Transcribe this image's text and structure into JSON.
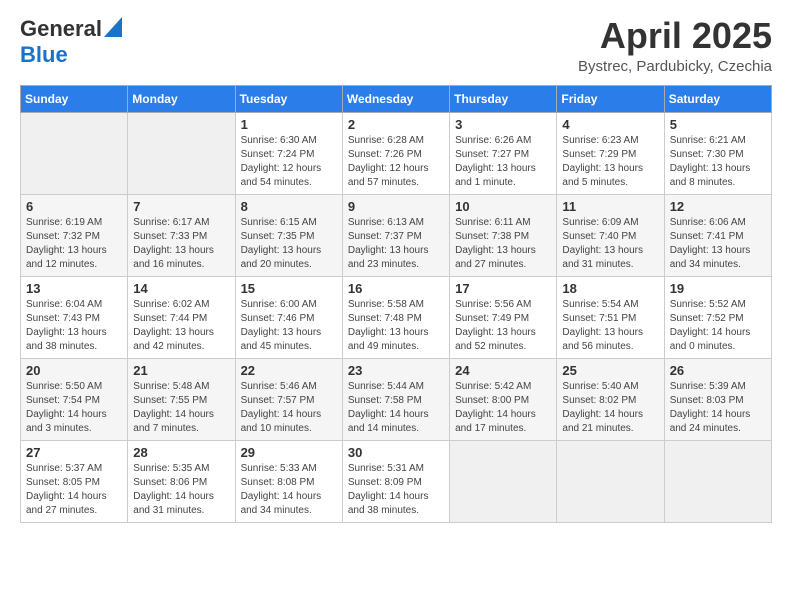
{
  "header": {
    "logo_general": "General",
    "logo_blue": "Blue",
    "month_title": "April 2025",
    "location": "Bystrec, Pardubicky, Czechia"
  },
  "weekdays": [
    "Sunday",
    "Monday",
    "Tuesday",
    "Wednesday",
    "Thursday",
    "Friday",
    "Saturday"
  ],
  "weeks": [
    [
      {
        "day": "",
        "info": ""
      },
      {
        "day": "",
        "info": ""
      },
      {
        "day": "1",
        "info": "Sunrise: 6:30 AM\nSunset: 7:24 PM\nDaylight: 12 hours\nand 54 minutes."
      },
      {
        "day": "2",
        "info": "Sunrise: 6:28 AM\nSunset: 7:26 PM\nDaylight: 12 hours\nand 57 minutes."
      },
      {
        "day": "3",
        "info": "Sunrise: 6:26 AM\nSunset: 7:27 PM\nDaylight: 13 hours\nand 1 minute."
      },
      {
        "day": "4",
        "info": "Sunrise: 6:23 AM\nSunset: 7:29 PM\nDaylight: 13 hours\nand 5 minutes."
      },
      {
        "day": "5",
        "info": "Sunrise: 6:21 AM\nSunset: 7:30 PM\nDaylight: 13 hours\nand 8 minutes."
      }
    ],
    [
      {
        "day": "6",
        "info": "Sunrise: 6:19 AM\nSunset: 7:32 PM\nDaylight: 13 hours\nand 12 minutes."
      },
      {
        "day": "7",
        "info": "Sunrise: 6:17 AM\nSunset: 7:33 PM\nDaylight: 13 hours\nand 16 minutes."
      },
      {
        "day": "8",
        "info": "Sunrise: 6:15 AM\nSunset: 7:35 PM\nDaylight: 13 hours\nand 20 minutes."
      },
      {
        "day": "9",
        "info": "Sunrise: 6:13 AM\nSunset: 7:37 PM\nDaylight: 13 hours\nand 23 minutes."
      },
      {
        "day": "10",
        "info": "Sunrise: 6:11 AM\nSunset: 7:38 PM\nDaylight: 13 hours\nand 27 minutes."
      },
      {
        "day": "11",
        "info": "Sunrise: 6:09 AM\nSunset: 7:40 PM\nDaylight: 13 hours\nand 31 minutes."
      },
      {
        "day": "12",
        "info": "Sunrise: 6:06 AM\nSunset: 7:41 PM\nDaylight: 13 hours\nand 34 minutes."
      }
    ],
    [
      {
        "day": "13",
        "info": "Sunrise: 6:04 AM\nSunset: 7:43 PM\nDaylight: 13 hours\nand 38 minutes."
      },
      {
        "day": "14",
        "info": "Sunrise: 6:02 AM\nSunset: 7:44 PM\nDaylight: 13 hours\nand 42 minutes."
      },
      {
        "day": "15",
        "info": "Sunrise: 6:00 AM\nSunset: 7:46 PM\nDaylight: 13 hours\nand 45 minutes."
      },
      {
        "day": "16",
        "info": "Sunrise: 5:58 AM\nSunset: 7:48 PM\nDaylight: 13 hours\nand 49 minutes."
      },
      {
        "day": "17",
        "info": "Sunrise: 5:56 AM\nSunset: 7:49 PM\nDaylight: 13 hours\nand 52 minutes."
      },
      {
        "day": "18",
        "info": "Sunrise: 5:54 AM\nSunset: 7:51 PM\nDaylight: 13 hours\nand 56 minutes."
      },
      {
        "day": "19",
        "info": "Sunrise: 5:52 AM\nSunset: 7:52 PM\nDaylight: 14 hours\nand 0 minutes."
      }
    ],
    [
      {
        "day": "20",
        "info": "Sunrise: 5:50 AM\nSunset: 7:54 PM\nDaylight: 14 hours\nand 3 minutes."
      },
      {
        "day": "21",
        "info": "Sunrise: 5:48 AM\nSunset: 7:55 PM\nDaylight: 14 hours\nand 7 minutes."
      },
      {
        "day": "22",
        "info": "Sunrise: 5:46 AM\nSunset: 7:57 PM\nDaylight: 14 hours\nand 10 minutes."
      },
      {
        "day": "23",
        "info": "Sunrise: 5:44 AM\nSunset: 7:58 PM\nDaylight: 14 hours\nand 14 minutes."
      },
      {
        "day": "24",
        "info": "Sunrise: 5:42 AM\nSunset: 8:00 PM\nDaylight: 14 hours\nand 17 minutes."
      },
      {
        "day": "25",
        "info": "Sunrise: 5:40 AM\nSunset: 8:02 PM\nDaylight: 14 hours\nand 21 minutes."
      },
      {
        "day": "26",
        "info": "Sunrise: 5:39 AM\nSunset: 8:03 PM\nDaylight: 14 hours\nand 24 minutes."
      }
    ],
    [
      {
        "day": "27",
        "info": "Sunrise: 5:37 AM\nSunset: 8:05 PM\nDaylight: 14 hours\nand 27 minutes."
      },
      {
        "day": "28",
        "info": "Sunrise: 5:35 AM\nSunset: 8:06 PM\nDaylight: 14 hours\nand 31 minutes."
      },
      {
        "day": "29",
        "info": "Sunrise: 5:33 AM\nSunset: 8:08 PM\nDaylight: 14 hours\nand 34 minutes."
      },
      {
        "day": "30",
        "info": "Sunrise: 5:31 AM\nSunset: 8:09 PM\nDaylight: 14 hours\nand 38 minutes."
      },
      {
        "day": "",
        "info": ""
      },
      {
        "day": "",
        "info": ""
      },
      {
        "day": "",
        "info": ""
      }
    ]
  ]
}
